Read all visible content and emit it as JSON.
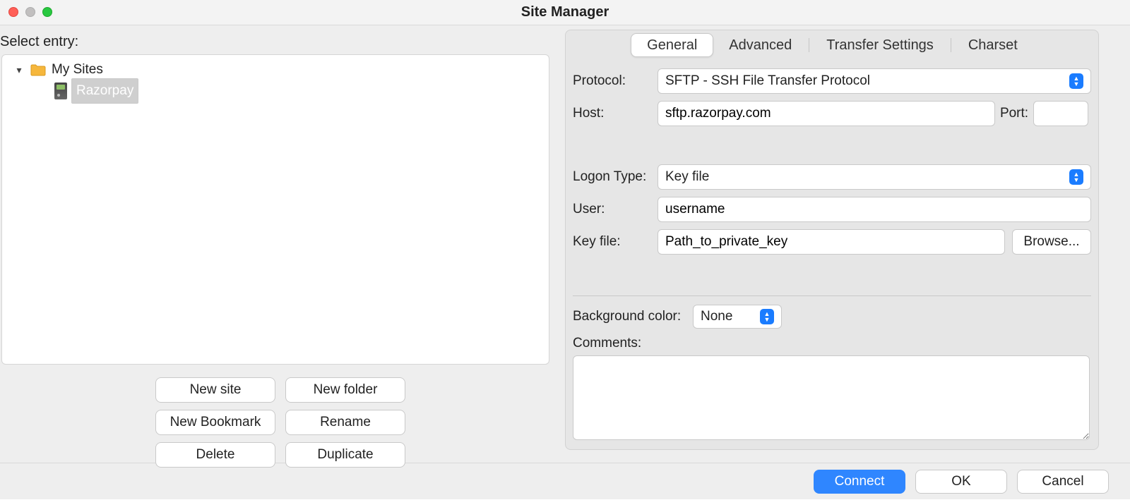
{
  "window": {
    "title": "Site Manager"
  },
  "left": {
    "select_entry_label": "Select entry:",
    "tree": {
      "root_label": "My Sites",
      "child_label": "Razorpay"
    },
    "buttons": {
      "new_site": "New site",
      "new_folder": "New folder",
      "new_bookmark": "New Bookmark",
      "rename": "Rename",
      "delete": "Delete",
      "duplicate": "Duplicate"
    }
  },
  "tabs": {
    "general": "General",
    "advanced": "Advanced",
    "transfer": "Transfer Settings",
    "charset": "Charset"
  },
  "form": {
    "protocol_label": "Protocol:",
    "protocol_value": "SFTP - SSH File Transfer Protocol",
    "host_label": "Host:",
    "host_value": "sftp.razorpay.com",
    "port_label": "Port:",
    "port_value": "",
    "logon_type_label": "Logon Type:",
    "logon_type_value": "Key file",
    "user_label": "User:",
    "user_value": "username",
    "keyfile_label": "Key file:",
    "keyfile_value": "Path_to_private_key",
    "browse_label": "Browse...",
    "bgcolor_label": "Background color:",
    "bgcolor_value": "None",
    "comments_label": "Comments:"
  },
  "footer": {
    "connect": "Connect",
    "ok": "OK",
    "cancel": "Cancel"
  }
}
